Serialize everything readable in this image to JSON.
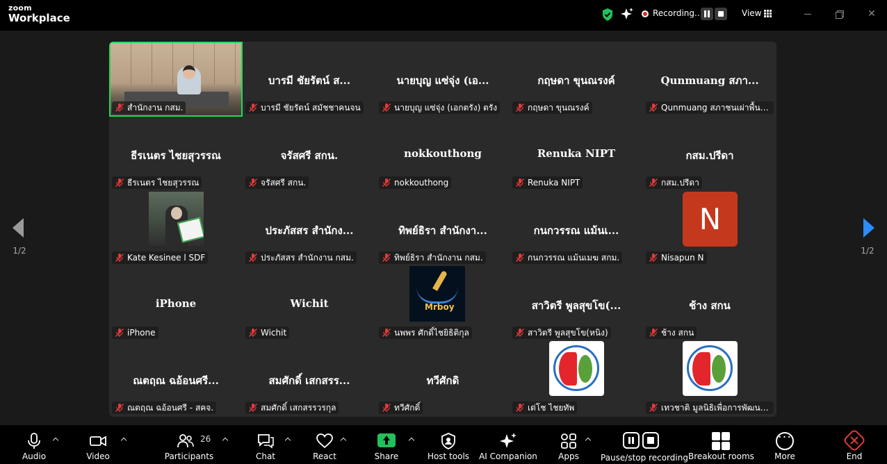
{
  "titlebar": {
    "brand_top": "zoom",
    "brand_bottom": "Workplace",
    "recording_label": "Recording...",
    "view_label": "View"
  },
  "navigation": {
    "left_page": "1/2",
    "right_page": "1/2"
  },
  "gallery": {
    "tiles": [
      {
        "big": "",
        "label": "สำนักงาน กสม.",
        "type": "video"
      },
      {
        "big": "บารมี ชัยรัตน์ ส...",
        "label": "บารมี ชัยรัตน์ สมัชชาคนจน"
      },
      {
        "big": "นายบุญ แซ่จุ่ง (เอ...",
        "label": "นายบุญ แซ่จุ่ง (เอกตรัง) ตรัง"
      },
      {
        "big": "กฤษดา ขุนณรงค์",
        "label": "กฤษดา ขุนณรงค์"
      },
      {
        "big": "Qunmuang สภา...",
        "label": "Qunmuang สภาชนเผ่าพื้นเมือง"
      },
      {
        "big": "ธีรเนตร ไชยสุวรรณ",
        "label": "ธีรเนตร ไชยสุวรรณ"
      },
      {
        "big": "จรัสศรี สกน.",
        "label": "จรัสศรี สกน."
      },
      {
        "big": "nokkouthong",
        "label": "nokkouthong"
      },
      {
        "big": "Renuka NIPT",
        "label": "Renuka NIPT"
      },
      {
        "big": "กสม.ปรีดา",
        "label": "กสม.ปรีดา"
      },
      {
        "big": "",
        "label": "Kate Kesinee l SDF",
        "type": "photo"
      },
      {
        "big": "ประภัสสร สำนักง...",
        "label": "ประภัสสร สำนักงาน กสม."
      },
      {
        "big": "ทิพย์ธิรา สำนักงา...",
        "label": "ทิพย์ธิรา สำนักงาน กสม."
      },
      {
        "big": "กนกวรรณ แม้นเ...",
        "label": "กนกวรรณ แม้นเมฆ สกม."
      },
      {
        "big": "",
        "label": "Nisapun N",
        "type": "avatar",
        "initial": "N"
      },
      {
        "big": "iPhone",
        "label": "iPhone"
      },
      {
        "big": "Wichit",
        "label": "Wichit"
      },
      {
        "big": "",
        "label": "นพพร ศักดิ์ไชยิธิติกุล",
        "type": "logo-book",
        "logo_text": "Mrboy"
      },
      {
        "big": "สาวิตรี พูลสุขโข(...",
        "label": "สาวิตรี พูลสุขโข(หนิง)"
      },
      {
        "big": "ช้าง สกน",
        "label": "ช้าง สกน"
      },
      {
        "big": "ณตฤณ ฉอ้อนศรี...",
        "label": "ณตฤณ ฉอ้อนศรี - สคจ."
      },
      {
        "big": "สมศักดิ์ เสกสรร...",
        "label": "สมศักดิ์ เสกสรรวรกุล"
      },
      {
        "big": "ทวีศักดิ",
        "label": "ทวีศักดิ์"
      },
      {
        "big": "",
        "label": "เด่โช ไชยทัพ",
        "type": "logo-face"
      },
      {
        "big": "",
        "label": "เทวชาติ มูลนิธิเพื่อการพัฒนาที่ยั่...",
        "type": "logo-face"
      }
    ]
  },
  "toolbar": {
    "audio": "Audio",
    "video": "Video",
    "participants": "Participants",
    "participants_count": "26",
    "chat": "Chat",
    "react": "React",
    "share": "Share",
    "host_tools": "Host tools",
    "ai_companion": "AI Companion",
    "apps": "Apps",
    "pause_stop_recording": "Pause/stop recording",
    "breakout_rooms": "Breakout rooms",
    "more": "More",
    "end": "End"
  },
  "colors": {
    "accent_blue": "#2d8cff",
    "active_speaker": "#23d959",
    "share_green": "#23c05a",
    "end_red": "#e23b3b",
    "avatar_n": "#c4391d"
  }
}
